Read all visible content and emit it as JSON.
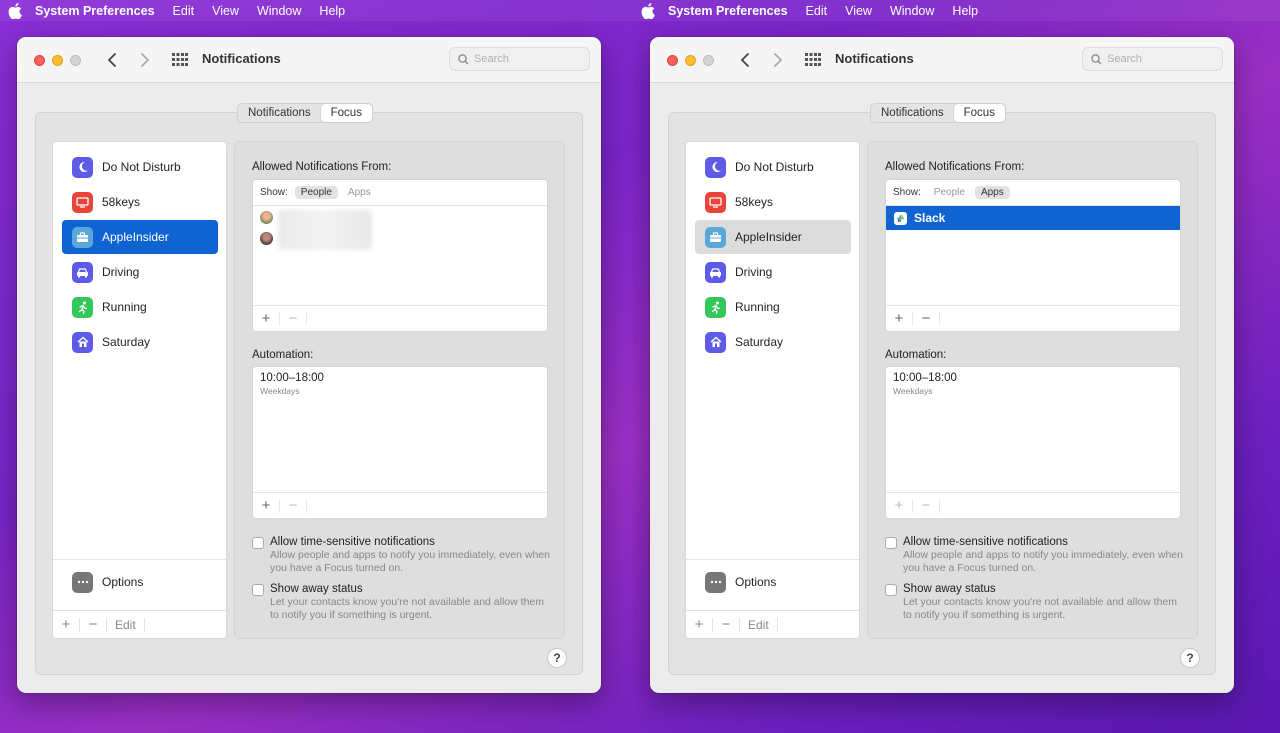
{
  "menubar": {
    "app": "System Preferences",
    "items": [
      "Edit",
      "View",
      "Window",
      "Help"
    ]
  },
  "window": {
    "title": "Notifications",
    "search_placeholder": "Search",
    "tabs": [
      "Notifications",
      "Focus"
    ],
    "selected_tab": "Focus"
  },
  "sidebar": {
    "items": [
      {
        "label": "Do Not Disturb",
        "icon": "moon-icon",
        "color": "#5e5ce6"
      },
      {
        "label": "58keys",
        "icon": "monitor-icon",
        "color": "#e8443a"
      },
      {
        "label": "AppleInsider",
        "icon": "briefcase-icon",
        "color": "#5aa8d8"
      },
      {
        "label": "Driving",
        "icon": "car-icon",
        "color": "#5e5ce6"
      },
      {
        "label": "Running",
        "icon": "running-icon",
        "color": "#34c759"
      },
      {
        "label": "Saturday",
        "icon": "house-icon",
        "color": "#5e5ce6"
      }
    ],
    "options_label": "Options",
    "footer": {
      "add": "+",
      "remove": "−",
      "edit": "Edit"
    }
  },
  "pane": {
    "allowed_label": "Allowed Notifications From:",
    "show_label": "Show:",
    "show_options": [
      "People",
      "Apps"
    ],
    "apps": [
      "Slack"
    ],
    "automation_label": "Automation:",
    "automation": {
      "time": "10:00–18:00",
      "days": "Weekdays"
    },
    "add": "+",
    "remove": "−",
    "time_sensitive": {
      "title": "Allow time-sensitive notifications",
      "desc": "Allow people and apps to notify you immediately, even when you have a Focus turned on."
    },
    "away_status": {
      "title": "Show away status",
      "desc": "Let your contacts know you're not available and allow them to notify you if something is urgent."
    },
    "help": "?"
  },
  "states": {
    "left": {
      "selected_sidebar": "AppleInsider",
      "show": "People"
    },
    "right": {
      "selected_sidebar": "AppleInsider",
      "show": "Apps"
    }
  },
  "colors": {
    "selection": "#0f64d2",
    "accent_red": "#fe5f57",
    "accent_yellow": "#febc2e"
  }
}
